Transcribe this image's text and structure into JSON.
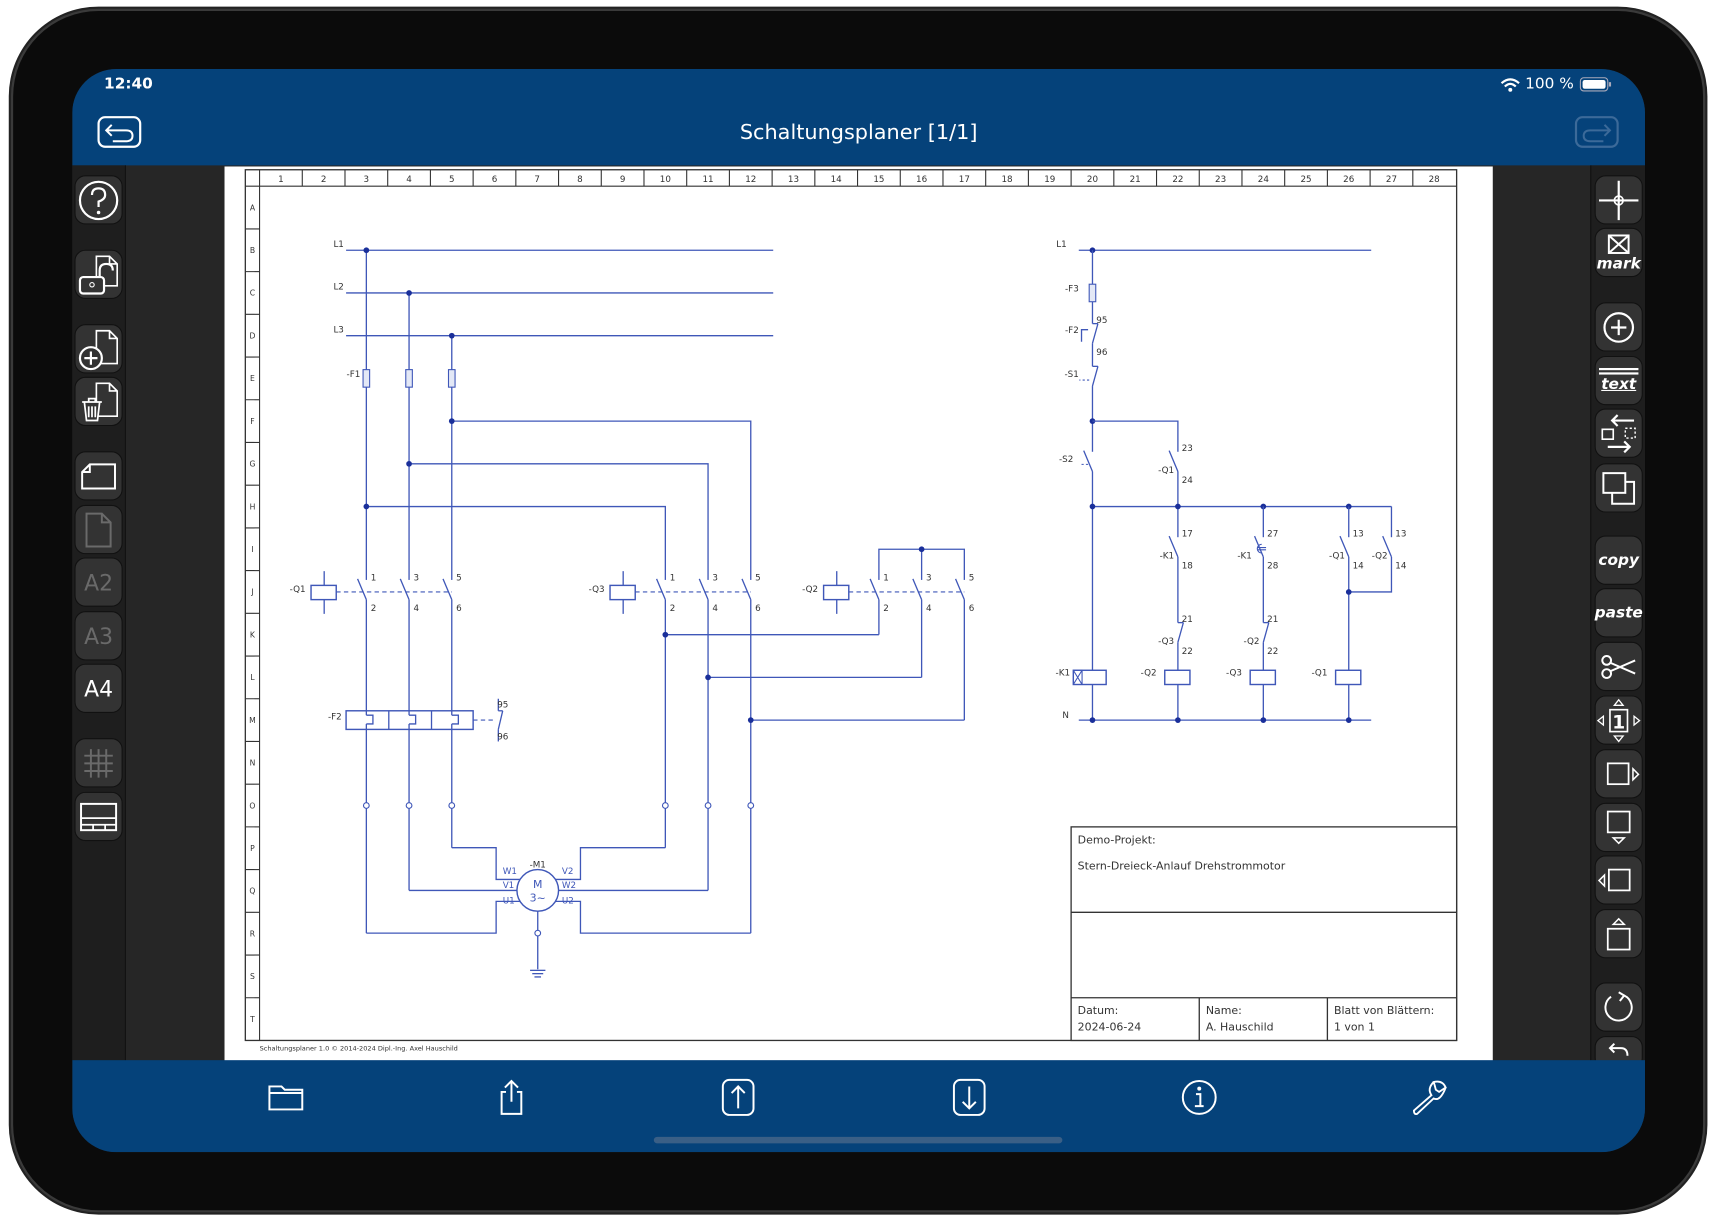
{
  "status_bar": {
    "time": "12:40",
    "battery": "100 %"
  },
  "header": {
    "title": "Schaltungsplaner [1/1]",
    "back_icon": "undo-arrow-icon",
    "forward_icon": "redo-arrow-icon"
  },
  "colors": {
    "header": "#05427a",
    "wire": "#3f57b8",
    "node": "#1a2f9a",
    "toolbar": "#333333",
    "workspace": "#262626"
  },
  "left_toolbar": [
    {
      "icon": "help-icon"
    },
    {
      "icon": "unlock-document-icon"
    },
    {
      "icon": "add-document-icon"
    },
    {
      "icon": "delete-document-icon"
    },
    {
      "icon": "page-landscape-icon"
    },
    {
      "icon": "page-portrait-icon",
      "disabled": true
    },
    {
      "label": "A2",
      "disabled": true
    },
    {
      "label": "A3",
      "disabled": true
    },
    {
      "label": "A4"
    },
    {
      "icon": "grid-icon",
      "disabled": true
    },
    {
      "icon": "title-block-icon"
    }
  ],
  "right_toolbar": {
    "crosshair_icon": "crosshair-icon",
    "mark": "mark",
    "add_icon": "plus-circle-icon",
    "text": "text",
    "swap_icon": "swap-icon",
    "duplicate_icon": "duplicate-icon",
    "copy": "copy",
    "paste": "paste",
    "cut_icon": "scissors-icon",
    "move_value": "1",
    "rotate_icon": "rotate-icon",
    "undo_icon": "undo-icon"
  },
  "sheet": {
    "columns": [
      "1",
      "2",
      "3",
      "4",
      "5",
      "6",
      "7",
      "8",
      "9",
      "10",
      "11",
      "12",
      "13",
      "14",
      "15",
      "16",
      "17",
      "18",
      "19",
      "20",
      "21",
      "22",
      "23",
      "24",
      "25",
      "26",
      "27",
      "28"
    ],
    "rows": [
      "A",
      "B",
      "C",
      "D",
      "E",
      "F",
      "G",
      "H",
      "I",
      "J",
      "K",
      "L",
      "M",
      "N",
      "O",
      "P",
      "Q",
      "R",
      "S",
      "T"
    ],
    "footer": "Schaltungsplaner 1.0   © 2014-2024 Dipl.-Ing. Axel Hauschild"
  },
  "schematic": {
    "L1": "L1",
    "L2": "L2",
    "L3": "L3",
    "N": "N",
    "F1": "-F1",
    "F2": "-F2",
    "F3": "-F3",
    "S1": "-S1",
    "S2": "-S2",
    "Q1": "-Q1",
    "Q2": "-Q2",
    "Q3": "-Q3",
    "K1": "-K1",
    "M1": "-M1",
    "motor_M": "M",
    "motor_3": "3~",
    "U1": "U1",
    "V1": "V1",
    "W1": "W1",
    "U2": "U2",
    "V2": "V2",
    "W2": "W2",
    "pins": {
      "p1": "1",
      "p2": "2",
      "p3": "3",
      "p4": "4",
      "p5": "5",
      "p6": "6",
      "p13": "13",
      "p14": "14",
      "p17": "17",
      "p18": "18",
      "p21": "21",
      "p22": "22",
      "p23": "23",
      "p24": "24",
      "p27": "27",
      "p28": "28",
      "p95": "95",
      "p96": "96"
    }
  },
  "title_block": {
    "project_label": "Demo-Projekt:",
    "project_name": "Stern-Dreieck-Anlauf Drehstrommotor",
    "date_label": "Datum:",
    "date": "2024-06-24",
    "name_label": "Name:",
    "name": "A. Hauschild",
    "sheet_label": "Blatt von Blättern:",
    "sheet": "1 von 1"
  },
  "bottom_bar": [
    {
      "icon": "folder-icon"
    },
    {
      "icon": "share-icon"
    },
    {
      "icon": "upload-icon"
    },
    {
      "icon": "download-icon"
    },
    {
      "icon": "info-icon"
    },
    {
      "icon": "wrench-icon"
    }
  ]
}
